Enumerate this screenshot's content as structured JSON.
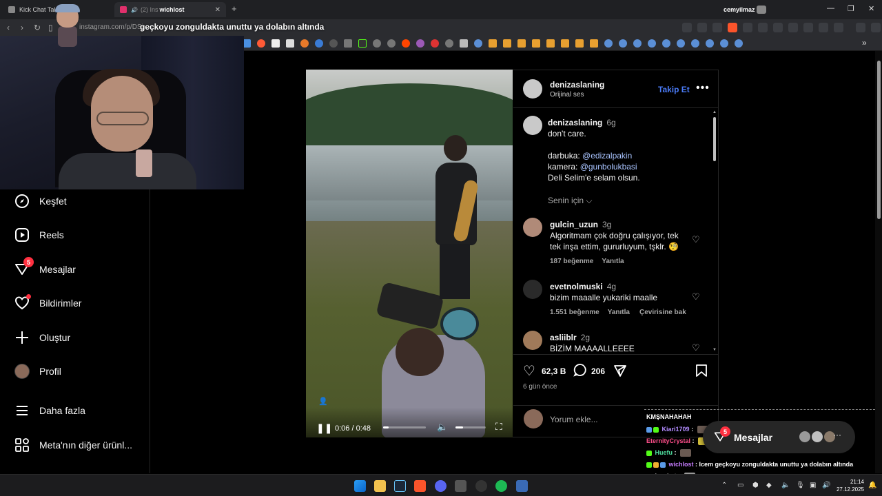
{
  "browser": {
    "tabs": [
      {
        "title": "Kick Chat Takip | W"
      },
      {
        "title": "wichlost",
        "extra": "(2) Ins"
      }
    ],
    "profile": "cemyilmaz",
    "url": "instagram.com/p/DSi",
    "url_overlay": "geçkoyu zonguldakta unuttu ya dolabın altında"
  },
  "nav": {
    "items": [
      {
        "label": "Keşfet",
        "icon": "compass-icon"
      },
      {
        "label": "Reels",
        "icon": "reels-icon"
      },
      {
        "label": "Mesajlar",
        "icon": "messenger-icon",
        "badge": "5"
      },
      {
        "label": "Bildirimler",
        "icon": "heart-icon"
      },
      {
        "label": "Oluştur",
        "icon": "plus-icon"
      },
      {
        "label": "Profil",
        "icon": "avatar"
      },
      {
        "label": "Daha fazla",
        "icon": "menu-icon"
      },
      {
        "label": "Meta'nın diğer ürünl...",
        "icon": "apps-icon"
      }
    ]
  },
  "video": {
    "time": "0:06 / 0:48",
    "progress": 0.125,
    "volume": 0.25
  },
  "post": {
    "author": "denizaslaning",
    "audio": "Orijinal ses",
    "follow": "Takip Et",
    "caption": {
      "user": "denizaslaning",
      "age": "6g",
      "line1": "don't care.",
      "darbuka_label": "darbuka: ",
      "darbuka_user": "@edizalpakin",
      "kamera_label": "kamera: ",
      "kamera_user": "@gunbolukbasi",
      "line4": "Deli Selim'e selam olsun."
    },
    "sort": "Senin için",
    "comments": [
      {
        "user": "gulcin_uzun",
        "age": "3g",
        "text": "Algoritmam çok doğru çalışıyor, tek tek inşa ettim, gururluyum, tşklr. 🧐",
        "likes": "187 beğenme",
        "reply": "Yanıtla",
        "translate": ""
      },
      {
        "user": "evetnolmuski",
        "age": "4g",
        "text": "bizim maaalle yukariki maalle",
        "likes": "1.551 beğenme",
        "reply": "Yanıtla",
        "translate": "Çevirisine bak"
      },
      {
        "user": "asliiblr",
        "age": "2g",
        "text": "BİZİM MAAAALLEEEE",
        "likes": "",
        "reply": "",
        "translate": ""
      }
    ],
    "likes": "62,3 B",
    "comment_count": "206",
    "posted": "6 gün önce",
    "comment_placeholder": "Yorum ekle..."
  },
  "chat": {
    "header": "KMŞNAHAHAH",
    "lines": [
      {
        "user": "Kiari1709",
        "msg": ":",
        "color": "#b28bff"
      },
      {
        "user": "EternityCrystal",
        "msg": ":",
        "color": "#ff4f8b"
      },
      {
        "user": "Huefu",
        "msg": ":",
        "color": "#4fe0a0"
      },
      {
        "user": "wichlost",
        "msg": ": Icem geçkoyu zonguldakta unuttu ya dolabın altında",
        "color": "#c77dff"
      },
      {
        "user": "iceekut",
        "msg": ":",
        "color": "#ffffff"
      }
    ]
  },
  "messages_pill": {
    "label": "Mesajlar",
    "badge": "5"
  },
  "taskbar": {
    "time": "21:14",
    "date": "27.12.2025"
  }
}
